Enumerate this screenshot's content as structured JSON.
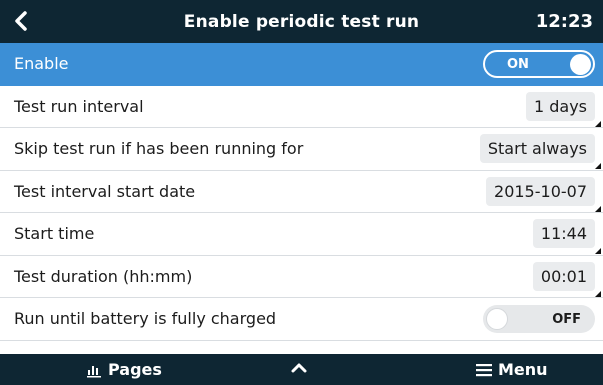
{
  "header": {
    "title": "Enable periodic test run",
    "time": "12:23",
    "back_icon": "chevron-left-icon"
  },
  "rows": [
    {
      "label": "Enable",
      "toggle": "ON",
      "selected": true
    },
    {
      "label": "Test run interval",
      "value": "1 days"
    },
    {
      "label": "Skip test run if has been running for",
      "value": "Start always"
    },
    {
      "label": "Test interval start date",
      "value": "2015-10-07"
    },
    {
      "label": "Start time",
      "value": "11:44"
    },
    {
      "label": "Test duration (hh:mm)",
      "value": "00:01"
    },
    {
      "label": "Run until battery is fully charged",
      "toggle": "OFF"
    }
  ],
  "bottom": {
    "pages_label": "Pages",
    "menu_label": "Menu",
    "pages_icon": "bar-chart-icon",
    "up_icon": "chevron-up-icon",
    "menu_icon": "hamburger-icon"
  },
  "colors": {
    "header_bg": "#0e2633",
    "selected_row": "#3c8fd6",
    "value_box": "#eaecee"
  }
}
